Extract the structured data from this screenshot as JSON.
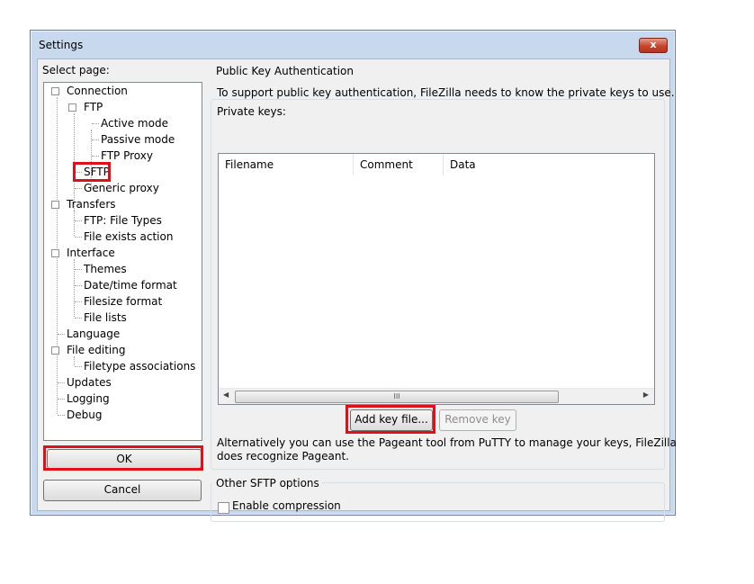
{
  "window": {
    "title": "Settings",
    "close_label": "x"
  },
  "left_panel": {
    "select_page_label": "Select page:",
    "tree": [
      {
        "label": "Connection",
        "expander": "⊟"
      },
      {
        "label": "FTP",
        "expander": "⊟"
      },
      {
        "label": "Active mode"
      },
      {
        "label": "Passive mode"
      },
      {
        "label": "FTP Proxy"
      },
      {
        "label": "SFTP"
      },
      {
        "label": "Generic proxy"
      },
      {
        "label": "Transfers",
        "expander": "⊟"
      },
      {
        "label": "FTP: File Types"
      },
      {
        "label": "File exists action"
      },
      {
        "label": "Interface",
        "expander": "⊟"
      },
      {
        "label": "Themes"
      },
      {
        "label": "Date/time format"
      },
      {
        "label": "Filesize format"
      },
      {
        "label": "File lists"
      },
      {
        "label": "Language"
      },
      {
        "label": "File editing",
        "expander": "⊟"
      },
      {
        "label": "Filetype associations"
      },
      {
        "label": "Updates"
      },
      {
        "label": "Logging"
      },
      {
        "label": "Debug"
      }
    ],
    "ok_label": "OK",
    "cancel_label": "Cancel"
  },
  "pubkey_group": {
    "title": "Public Key Authentication",
    "description": "To support public key authentication, FileZilla needs to know the private keys to use.",
    "private_keys_label": "Private keys:",
    "columns": [
      "Filename",
      "Comment",
      "Data"
    ],
    "scroll_thumb_grip": "III",
    "add_key_label": "Add key file...",
    "remove_key_label": "Remove key",
    "pageant_note_line1": "Alternatively you can use the Pageant tool from PuTTY to manage your keys, FileZilla",
    "pageant_note_line2": "does recognize Pageant."
  },
  "sftp_options_group": {
    "title": "Other SFTP options",
    "enable_compression_label": "Enable compression",
    "enable_compression_checked": false
  },
  "colors": {
    "highlight_red": "#e0101a",
    "titlebar": "#c8d9ee",
    "close_button": "#c6452f"
  }
}
